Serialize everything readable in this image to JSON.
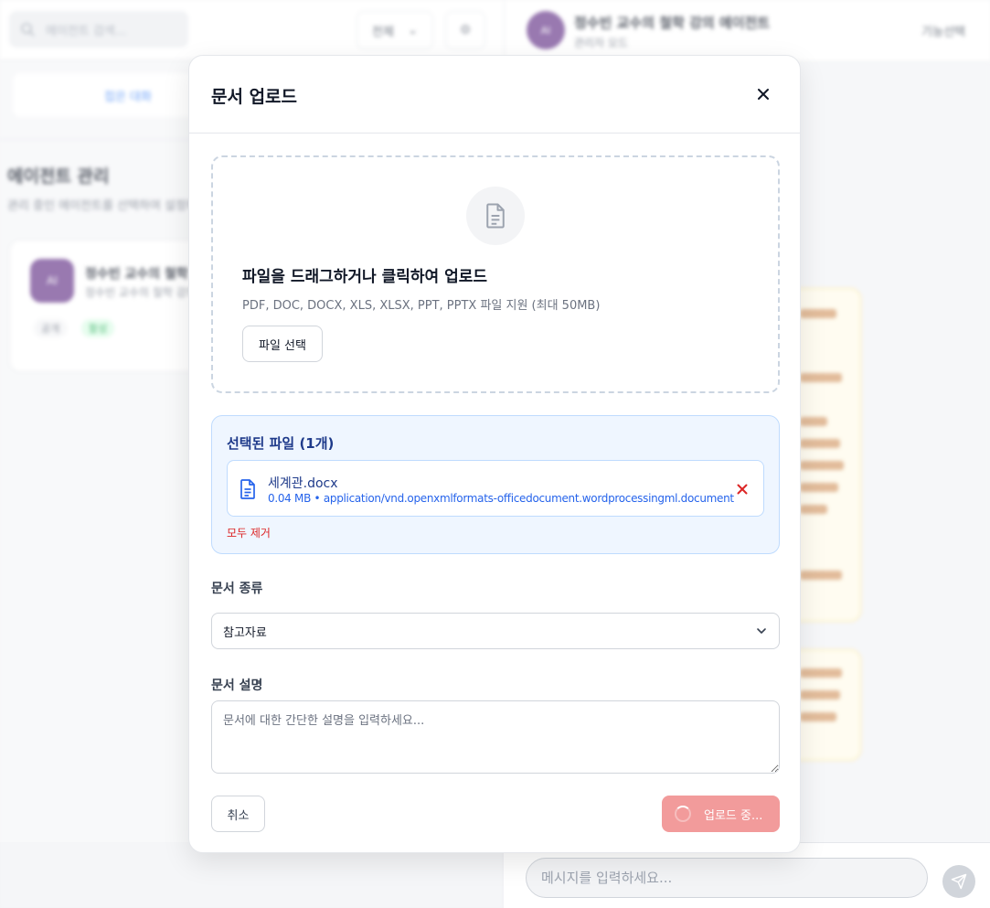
{
  "background": {
    "search": {
      "placeholder": "에이전트 검색..."
    },
    "filter": {
      "value": "전체"
    },
    "agent_select_button": "접은 대화",
    "section": {
      "title": "에이전트 관리",
      "subtitle": "관리 중인 에이전트를 선택하여 설정하세요"
    },
    "agent_card": {
      "avatar_text": "AI",
      "name": "정수빈 교수의 철학 강의",
      "description": "정수빈 교수의 철학 강의 에이전트",
      "tags": [
        "공개",
        "활성"
      ]
    },
    "chat": {
      "avatar_text": "AI",
      "title": "정수빈 교수의 철학 강의 에이전트",
      "subtitle": "관리자 모드",
      "link": "기능선택",
      "input_placeholder": "메시지를 입력하세요..."
    }
  },
  "modal": {
    "title": "문서 업로드",
    "dropzone": {
      "title": "파일을 드래그하거나 클릭하여 업로드",
      "subtitle": "PDF, DOC, DOCX, XLS, XLSX, PPT, PPTX 파일 지원 (최대 50MB)",
      "button": "파일 선택"
    },
    "selected": {
      "title": "선택된 파일 (1개)",
      "files": [
        {
          "name": "세계관.docx",
          "meta": "0.04 MB • application/vnd.openxmlformats-officedocument.wordprocessingml.document"
        }
      ],
      "remove_all": "모두 제거"
    },
    "doc_type": {
      "label": "문서 종류",
      "value": "참고자료"
    },
    "doc_desc": {
      "label": "문서 설명",
      "placeholder": "문서에 대한 간단한 설명을 입력하세요..."
    },
    "cancel": "취소",
    "upload": "업로드 중..."
  },
  "colors": {
    "accent_blue": "#2563eb",
    "danger": "#dc2626",
    "upload_button": "#f29b9b"
  }
}
